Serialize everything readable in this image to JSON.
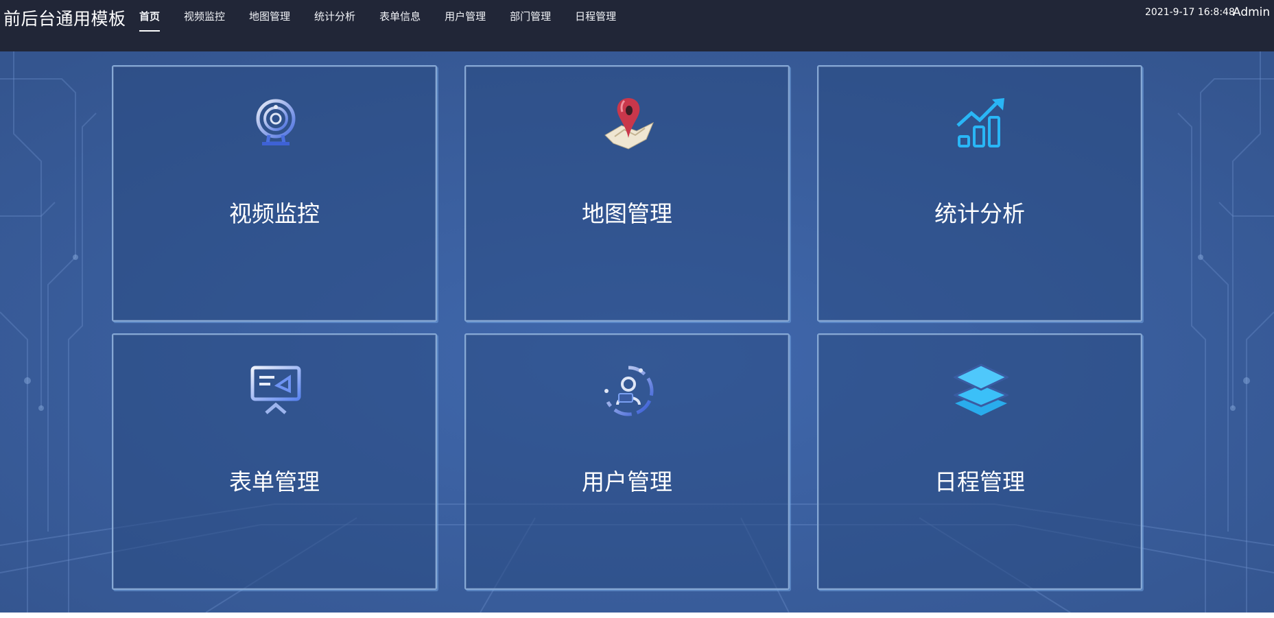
{
  "header": {
    "app_title": "前后台通用模板",
    "nav": [
      "首页",
      "视频监控",
      "地图管理",
      "统计分析",
      "表单信息",
      "用户管理",
      "部门管理",
      "日程管理"
    ],
    "datetime": "2021-9-17 16:8:48",
    "user": "Admin"
  },
  "cards": [
    {
      "label": "视频监控",
      "icon": "webcam-icon"
    },
    {
      "label": "地图管理",
      "icon": "map-pin-icon"
    },
    {
      "label": "统计分析",
      "icon": "bar-chart-trend-icon"
    },
    {
      "label": "表单管理",
      "icon": "presentation-board-icon"
    },
    {
      "label": "用户管理",
      "icon": "user-circle-icon"
    },
    {
      "label": "日程管理",
      "icon": "layers-icon"
    }
  ],
  "colors": {
    "header_bg": "#212637",
    "main_bg": "#3a5ca2",
    "accent": "#29b6f6"
  }
}
